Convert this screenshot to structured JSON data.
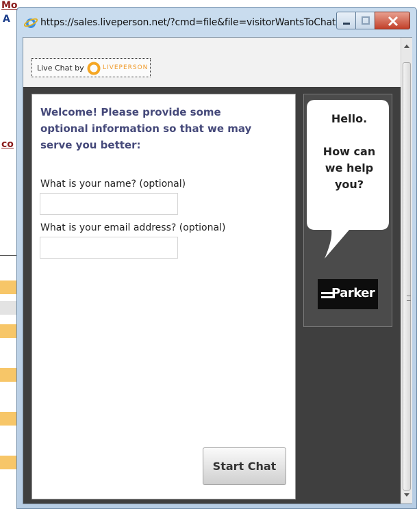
{
  "background_page": {
    "fragments": [
      "Mo",
      "A",
      "co"
    ]
  },
  "window": {
    "title": "https://sales.liveperson.net/?cmd=file&file=visitorWantsToChat...",
    "controls": [
      "minimize",
      "maximize",
      "close"
    ]
  },
  "header": {
    "badge_text": "Live Chat by",
    "brand": "LIVEPERSON"
  },
  "form": {
    "welcome": "Welcome! Please provide some optional information so that we may serve you better:",
    "name_label": "What is your name? (optional)",
    "name_value": "",
    "email_label": "What is your email address? (optional)",
    "email_value": "",
    "start_button": "Start Chat"
  },
  "side": {
    "bubble_text": "Hello.\n\nHow can we help you?",
    "logo_text": "Parker"
  },
  "colors": {
    "welcome_text": "#45497a",
    "dark_background": "#3f3f3f",
    "brand_orange": "#f09a2a"
  }
}
